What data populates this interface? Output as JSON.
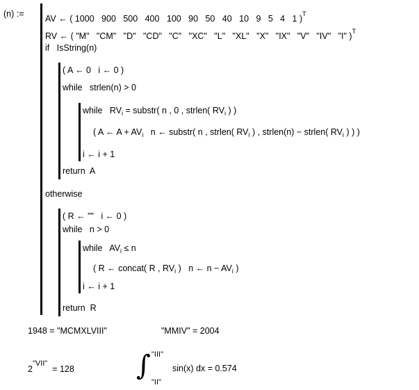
{
  "definition": {
    "lhs": "(n) :=",
    "lines": [
      {
        "id": "av",
        "indent": 0,
        "tokens": [
          {
            "t": "AV ← ( 1000   900   500   400   100   90   50   40   10   9   5   4   1 )"
          },
          {
            "sup": "T"
          }
        ]
      },
      {
        "id": "rv",
        "indent": 0,
        "tokens": [
          {
            "t": "RV ← ( \"M\"   \"CM\"   \"D\"   \"CD\"   \"C\"   \"XC\"   \"L\"   \"XL\"   \"X\"   \"IX\"   \"V\"   \"IV\"   \"I\" )"
          },
          {
            "sup": "T"
          }
        ]
      },
      {
        "id": "if",
        "indent": 0,
        "tokens": [
          {
            "t": "if   IsString(n)"
          }
        ]
      },
      {
        "id": "init-a",
        "indent": 1,
        "tokens": [
          {
            "t": "( A ← 0   i ← 0 )"
          }
        ]
      },
      {
        "id": "while-strlen",
        "indent": 1,
        "tokens": [
          {
            "t": "while   strlen(n) > 0"
          }
        ]
      },
      {
        "id": "while-rv",
        "indent": 2,
        "tokens": [
          {
            "t": "while   RV"
          },
          {
            "sub": "i"
          },
          {
            "t": " = substr( n , 0 , strlen( RV"
          },
          {
            "sub": "i"
          },
          {
            "t": " ) )"
          }
        ]
      },
      {
        "id": "update-a",
        "indent": 3,
        "tokens": [
          {
            "t": "( A ← A + AV"
          },
          {
            "sub": "i"
          },
          {
            "t": "   n ← substr( n , strlen( RV"
          },
          {
            "sub": "i"
          },
          {
            "t": " ) , strlen(n) − strlen( RV"
          },
          {
            "sub": "i"
          },
          {
            "t": " ) ) )"
          }
        ]
      },
      {
        "id": "inc-1",
        "indent": 2,
        "tokens": [
          {
            "t": "i ← i + 1"
          }
        ]
      },
      {
        "id": "return-a",
        "indent": 1,
        "tokens": [
          {
            "t": "return  A"
          }
        ]
      },
      {
        "id": "otherwise",
        "indent": 0,
        "tokens": [
          {
            "t": "otherwise"
          }
        ]
      },
      {
        "id": "init-r",
        "indent": 1,
        "tokens": [
          {
            "t": "( R ← \"\"   i ← 0 )"
          }
        ]
      },
      {
        "id": "while-n",
        "indent": 1,
        "tokens": [
          {
            "t": "while   n > 0"
          }
        ]
      },
      {
        "id": "while-av",
        "indent": 2,
        "tokens": [
          {
            "t": "while   AV"
          },
          {
            "sub": "i"
          },
          {
            "t": " ≤ n"
          }
        ]
      },
      {
        "id": "update-r",
        "indent": 3,
        "tokens": [
          {
            "t": "( R ← concat( R , RV"
          },
          {
            "sub": "i"
          },
          {
            "t": " )   n ← n − AV"
          },
          {
            "sub": "i"
          },
          {
            "t": " )"
          }
        ]
      },
      {
        "id": "inc-2",
        "indent": 2,
        "tokens": [
          {
            "t": "i ← i + 1"
          }
        ]
      },
      {
        "id": "return-r",
        "indent": 1,
        "tokens": [
          {
            "t": "return  R"
          }
        ]
      }
    ]
  },
  "results": {
    "eq1": "1948 = \"MCMXLVIII\"",
    "eq2": "\"MMIV\" = 2004",
    "eq3_base": "2",
    "eq3_exp": "\"VII\"",
    "eq3_rhs": "= 128",
    "integral_upper": "\"III\"",
    "integral_lower": "\"II\"",
    "integral_body": "sin(x) dx = 0.574"
  }
}
